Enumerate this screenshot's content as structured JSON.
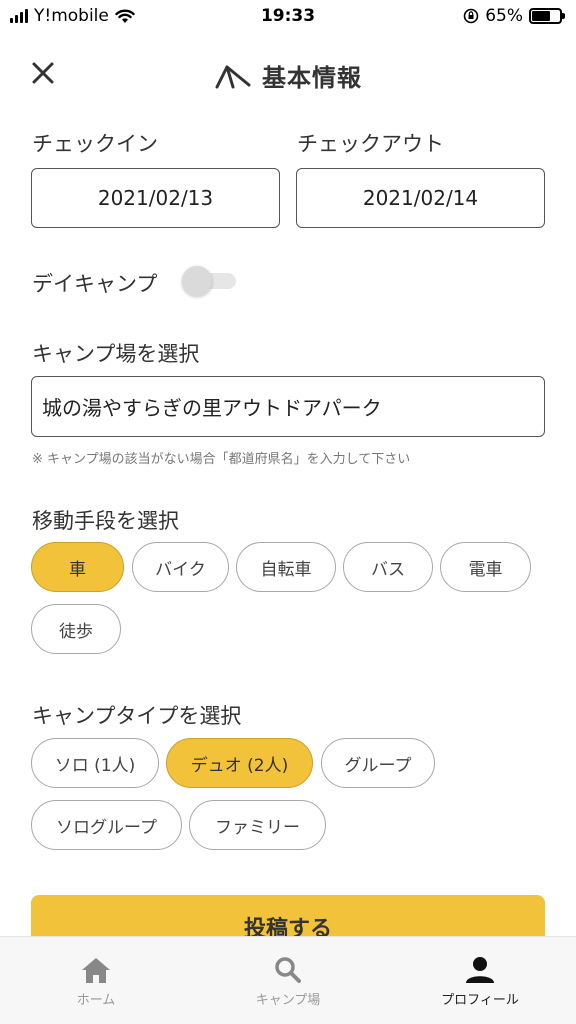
{
  "status_bar": {
    "carrier": "Y!mobile",
    "time": "19:33",
    "battery_text": "65%",
    "battery_level": 0.65
  },
  "header": {
    "title": "基本情報"
  },
  "checkin": {
    "label": "チェックイン",
    "value": "2021/02/13"
  },
  "checkout": {
    "label": "チェックアウト",
    "value": "2021/02/14"
  },
  "day_camp": {
    "label": "デイキャンプ",
    "enabled": false
  },
  "campsite": {
    "label": "キャンプ場を選択",
    "value": "城の湯やすらぎの里アウトドアパーク",
    "note": "※ キャンプ場の該当がない場合「都道府県名」を入力して下さい"
  },
  "transport": {
    "label": "移動手段を選択",
    "options": [
      "車",
      "バイク",
      "自転車",
      "バス",
      "電車",
      "徒歩"
    ],
    "selected": "車"
  },
  "camp_type": {
    "label": "キャンプタイプを選択",
    "options": [
      "ソロ (1人)",
      "デュオ (2人)",
      "グループ",
      "ソログループ",
      "ファミリー"
    ],
    "selected": "デュオ (2人)"
  },
  "submit": {
    "label": "投稿する"
  },
  "tab_bar": {
    "tabs": [
      {
        "label": "ホーム",
        "icon": "home-icon"
      },
      {
        "label": "キャンプ場",
        "icon": "search-icon"
      },
      {
        "label": "プロフィール",
        "icon": "person-icon"
      }
    ],
    "active": "プロフィール"
  },
  "colors": {
    "accent": "#f2c23a",
    "text": "#333333",
    "border": "#555555"
  }
}
